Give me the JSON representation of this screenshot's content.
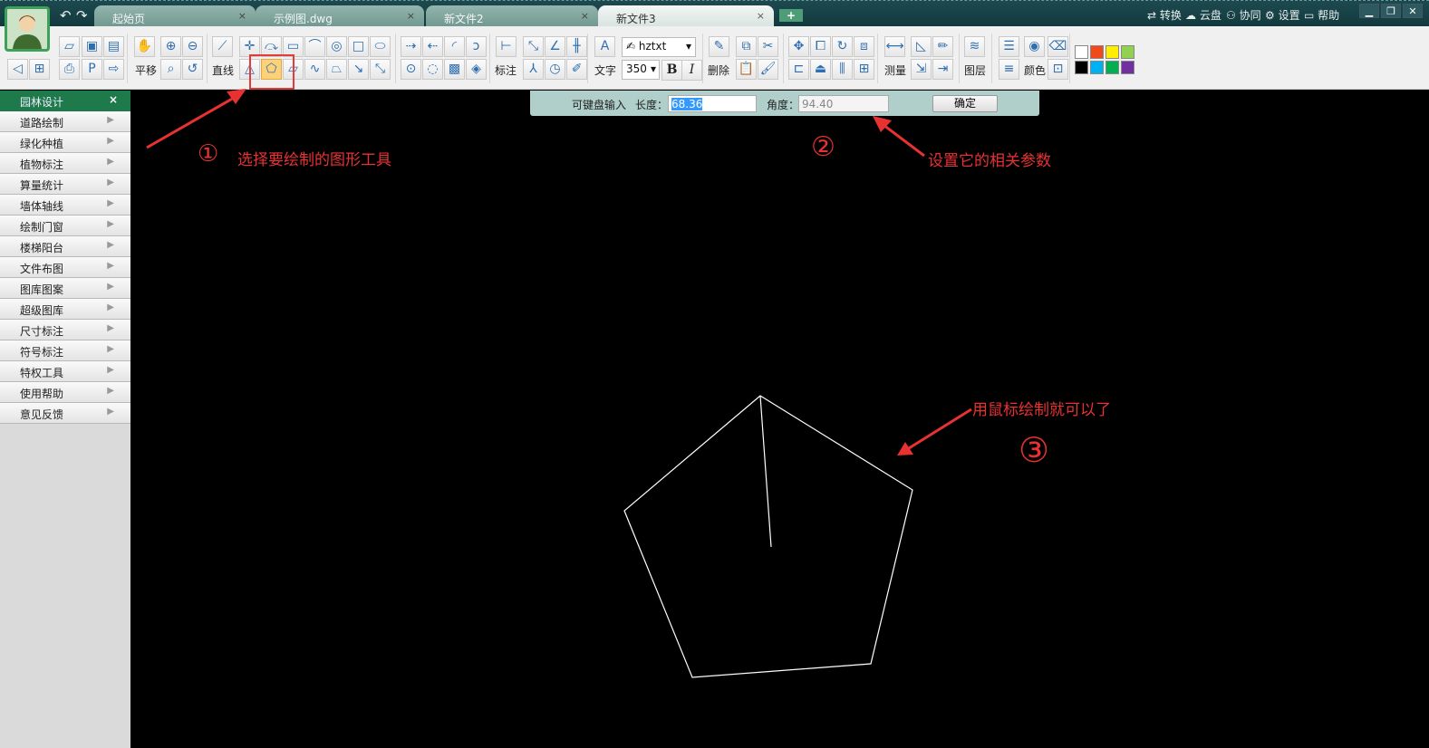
{
  "tabs": [
    {
      "label": "起始页"
    },
    {
      "label": "示例图.dwg"
    },
    {
      "label": "新文件2"
    },
    {
      "label": "新文件3",
      "active": true
    }
  ],
  "tab_close": "×",
  "add_tab": "+",
  "top_menu": [
    {
      "label": "⇄ 转换"
    },
    {
      "label": "☁ 云盘"
    },
    {
      "label": "⚇ 协同"
    },
    {
      "label": "⚙ 设置"
    },
    {
      "label": "▭ 帮助"
    }
  ],
  "window_controls": [
    "▁",
    "❐",
    "✕"
  ],
  "toolbar": {
    "labels": {
      "pan": "平移",
      "line": "直线",
      "dimension": "标注",
      "text": "文字",
      "delete": "删除",
      "measure": "测量",
      "layer": "图层",
      "color": "颜色"
    },
    "font": "hztxt",
    "font_size": "350",
    "bold": "B",
    "italic": "I",
    "selected_tool": "polygon",
    "icons": [
      "open",
      "save",
      "save-as",
      "pan-hand",
      "zoom-in",
      "zoom-out",
      "line",
      "crosshair",
      "break",
      "offset",
      "arc",
      "circle",
      "rectangle",
      "ellipse",
      "trim",
      "extend",
      "fillet",
      "chamfer",
      "dimension",
      "aligned-dim",
      "angle-dim",
      "continuous-dim",
      "text",
      "delete",
      "copy",
      "cut",
      "move",
      "scale",
      "rotate",
      "array",
      "measure",
      "area",
      "pencil",
      "layer",
      "linetype",
      "color-wheel",
      "erase-small",
      "back",
      "new",
      "print",
      "pdf",
      "export",
      "zoom-window",
      "zoom-previous",
      "triangle",
      "polygon",
      "parallelogram",
      "spline",
      "trapezoid",
      "arrow",
      "double-arrow",
      "circle-center",
      "circle-3p",
      "hatch",
      "fill",
      "fraction",
      "radius",
      "match-prop",
      "paste",
      "brush",
      "stretch",
      "offset-shape",
      "mirror",
      "grid-array",
      "insert-image",
      "insert-table",
      "line-weight",
      "block"
    ],
    "palette": [
      "#ffffff",
      "#f04a1a",
      "#ffee00",
      "#92d050",
      "#000000",
      "#00b0f0",
      "#00b050",
      "#7030a0"
    ]
  },
  "sidebar": {
    "title": "园林设计",
    "close": "×",
    "items": [
      {
        "label": "道路绘制"
      },
      {
        "label": "绿化种植"
      },
      {
        "label": "植物标注"
      },
      {
        "label": "算量统计"
      },
      {
        "label": "墙体轴线"
      },
      {
        "label": "绘制门窗"
      },
      {
        "label": "楼梯阳台"
      },
      {
        "label": "文件布图"
      },
      {
        "label": "图库图案"
      },
      {
        "label": "超级图库"
      },
      {
        "label": "尺寸标注"
      },
      {
        "label": "符号标注"
      },
      {
        "label": "特权工具"
      },
      {
        "label": "使用帮助"
      },
      {
        "label": "意见反馈"
      }
    ]
  },
  "input_bar": {
    "hint": "可键盘输入",
    "length_label": "长度：",
    "length_value": "68.36",
    "angle_label": "角度：",
    "angle_value": "94.40",
    "ok": "确定"
  },
  "annotations": {
    "a1": "选择要绘制的图形工具",
    "a2": "设置它的相关参数",
    "a3": "用鼠标绘制就可以了",
    "n1": "①",
    "n2": "②",
    "n3": "③"
  },
  "colors": {
    "titlebar": "#1d4a4f",
    "sidebar_header": "#1f7a4b",
    "annotation": "#e83232",
    "canvas": "#000000",
    "drawing": "#ffffff"
  }
}
